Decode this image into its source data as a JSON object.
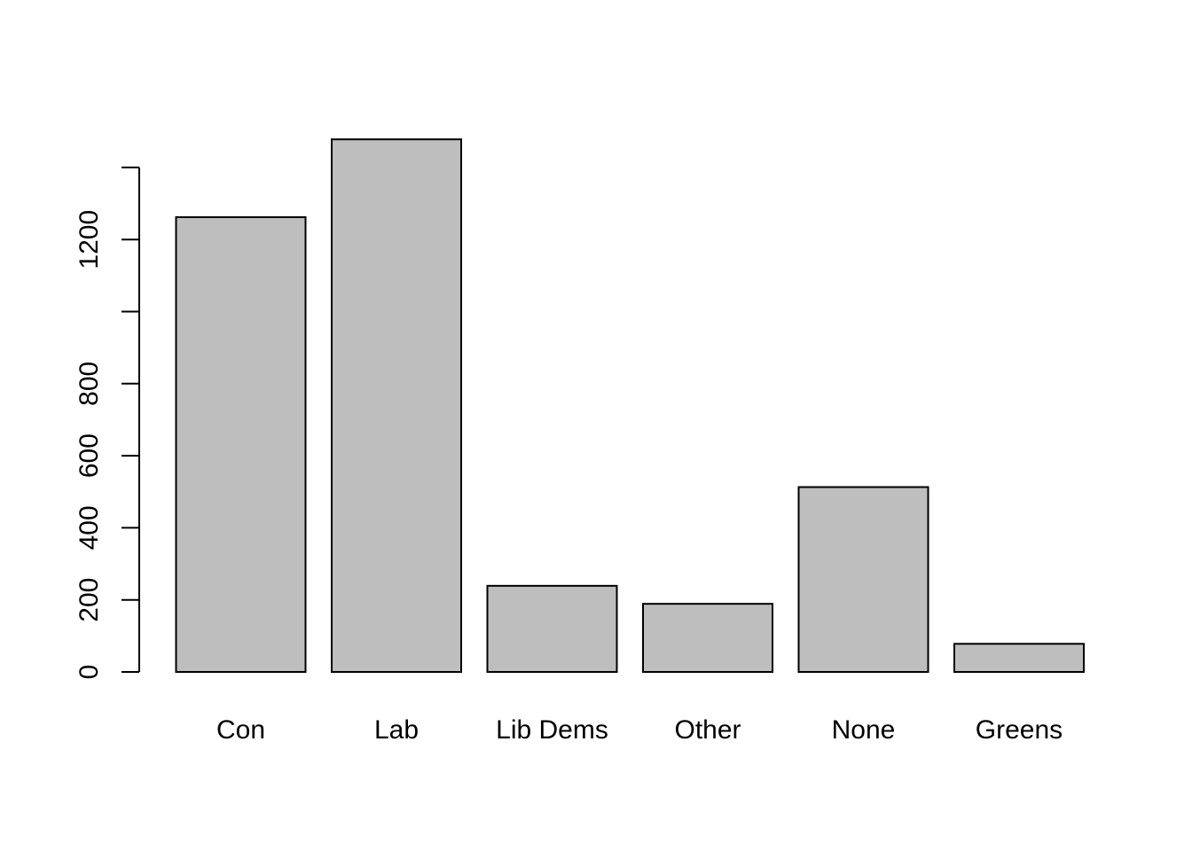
{
  "chart_data": {
    "type": "bar",
    "title": "",
    "xlabel": "",
    "ylabel": "",
    "categories": [
      "Con",
      "Lab",
      "Lib Dems",
      "Other",
      "None",
      "Greens"
    ],
    "values": [
      1262,
      1478,
      239,
      189,
      513,
      78
    ],
    "ylim": [
      0,
      1400
    ],
    "yticks": [
      0,
      200,
      400,
      600,
      800,
      1000,
      1200,
      1400
    ],
    "ytick_labels": [
      "0",
      "200",
      "400",
      "600",
      "800",
      "",
      "1200",
      ""
    ],
    "grid": false,
    "bar_color": "#bebebe",
    "edge_color": "#000000"
  }
}
